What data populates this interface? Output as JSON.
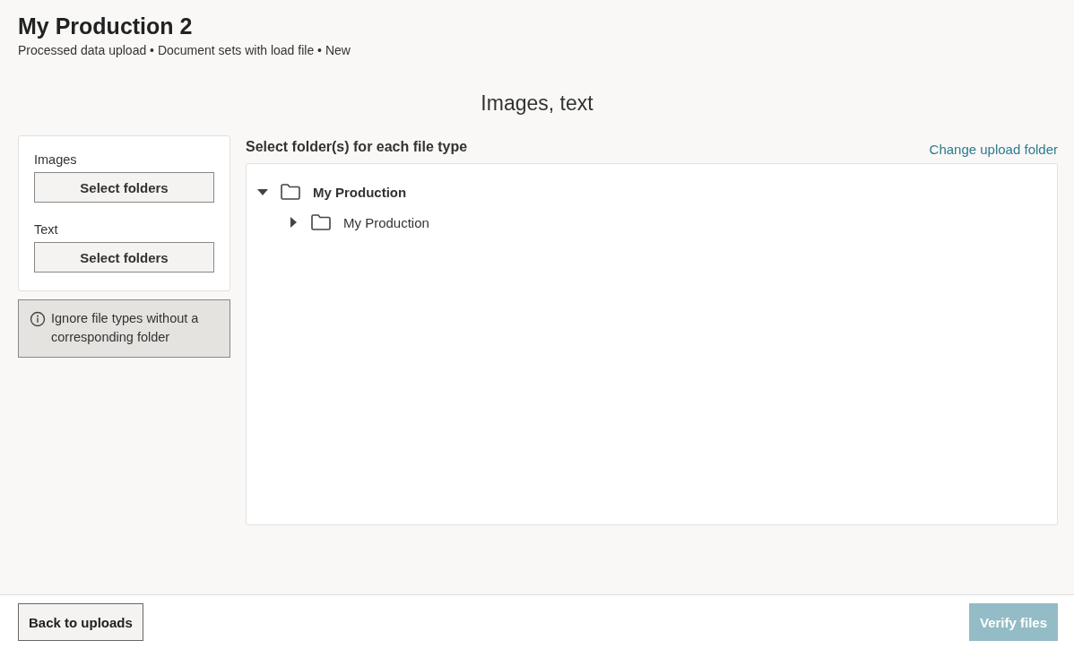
{
  "header": {
    "title": "My Production 2",
    "breadcrumb": "Processed data upload • Document sets with load file • New"
  },
  "section_title": "Images, text",
  "file_types": [
    {
      "label": "Images",
      "button": "Select folders"
    },
    {
      "label": "Text",
      "button": "Select folders"
    }
  ],
  "ignore_option": {
    "label": "Ignore file types without a corresponding folder",
    "selected": true
  },
  "folder_panel": {
    "heading": "Select folder(s) for each file type",
    "link": "Change upload folder",
    "tree": [
      {
        "label": "My Production",
        "expanded": true,
        "selected": true,
        "children": [
          {
            "label": "My Production",
            "expanded": false,
            "selected": false
          }
        ]
      }
    ]
  },
  "footer": {
    "back_button": {
      "label": "Back to uploads",
      "disabled": false
    },
    "verify_button": {
      "label": "Verify files",
      "disabled": true
    }
  }
}
